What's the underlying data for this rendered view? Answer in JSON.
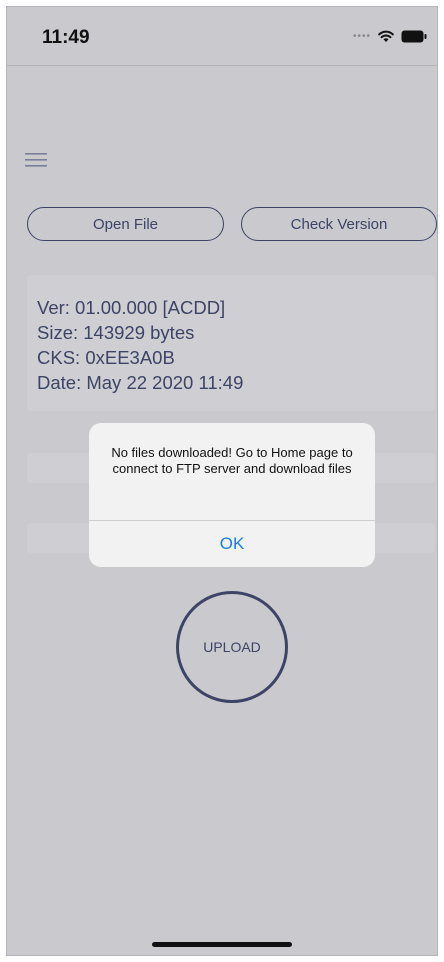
{
  "status_bar": {
    "time": "11:49"
  },
  "buttons": {
    "open_file": "Open File",
    "check_version": "Check Version",
    "upload": "UPLOAD"
  },
  "info": {
    "version": "Ver: 01.00.000 [ACDD]",
    "size": "Size: 143929 bytes",
    "checksum": "CKS: 0xEE3A0B",
    "date": "Date: May 22 2020 11:49"
  },
  "alert": {
    "message": "No files downloaded! Go to Home page to connect to FTP server and download files",
    "ok_label": "OK"
  },
  "colors": {
    "background": "#c9c9ce",
    "primary": "#3d4466",
    "alert_button": "#1a7cf2"
  },
  "icons": {
    "menu": "hamburger-menu-icon",
    "wifi": "wifi-icon",
    "battery": "battery-icon",
    "signal": "cellular-signal-icon"
  }
}
